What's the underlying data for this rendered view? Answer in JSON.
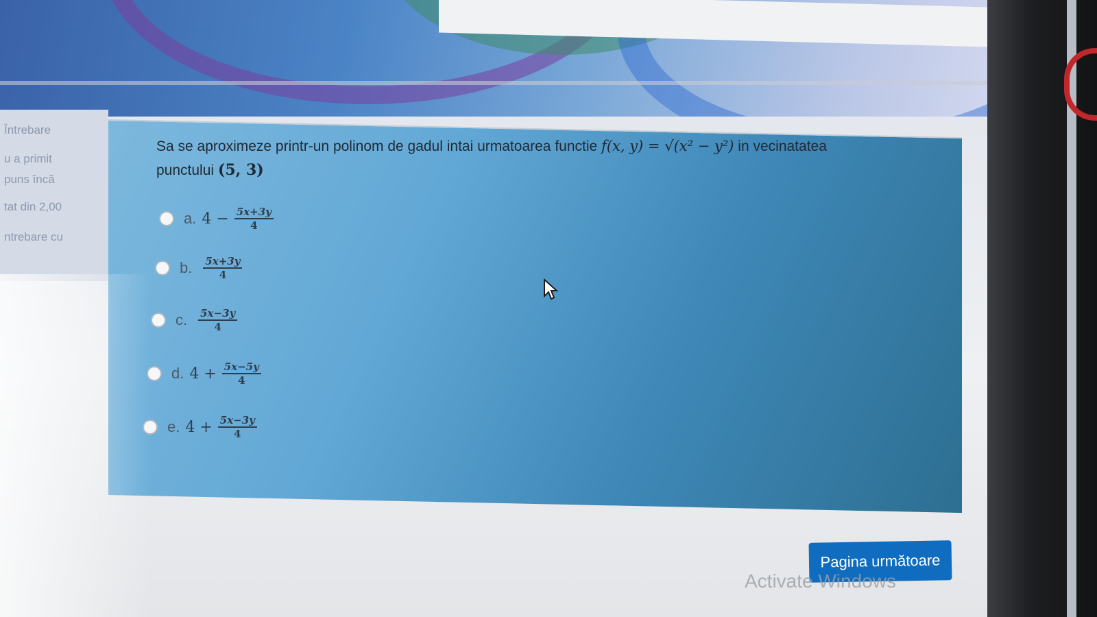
{
  "sidebar": {
    "lines": [
      "Întrebare",
      "u a primit",
      "puns încă",
      "tat din 2,00",
      "ntrebare cu"
    ]
  },
  "question": {
    "text_part1": "Sa se aproximeze printr-un polinom de gadul intai urmatoarea functie",
    "function": "f(x, y) = √(x² − y²)",
    "text_part2": "in vecinatatea",
    "text_part3": "punctului",
    "point": "(5, 3)"
  },
  "options": [
    {
      "letter": "a.",
      "prefix": "4 −",
      "numerator": "5x+3y",
      "denominator": "4"
    },
    {
      "letter": "b.",
      "prefix": "",
      "numerator": "5x+3y",
      "denominator": "4"
    },
    {
      "letter": "c.",
      "prefix": "",
      "numerator": "5x−3y",
      "denominator": "4"
    },
    {
      "letter": "d.",
      "prefix": "4 +",
      "numerator": "5x−5y",
      "denominator": "4"
    },
    {
      "letter": "e.",
      "prefix": "4 +",
      "numerator": "5x−3y",
      "denominator": "4"
    }
  ],
  "next_button": {
    "label": "Pagina următoare"
  },
  "watermark": {
    "text": "Activate Windows"
  },
  "colors": {
    "accent": "#0f6cbf",
    "question_bg": "#62a8d6"
  }
}
